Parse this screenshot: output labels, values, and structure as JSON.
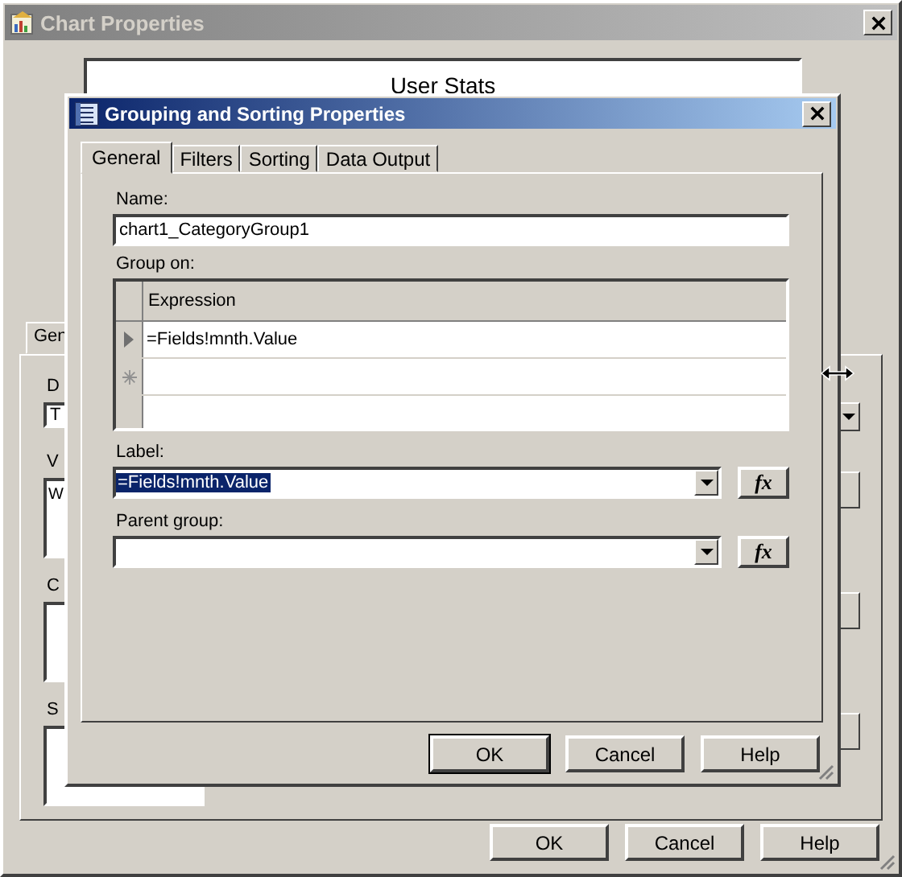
{
  "background_window": {
    "title": "Chart Properties",
    "chart_title": "User Stats",
    "tab": "Gen",
    "left_items": [
      {
        "kind": "label",
        "text": "D"
      },
      {
        "kind": "combo",
        "text": "T"
      },
      {
        "kind": "label",
        "text": "V"
      },
      {
        "kind": "list",
        "text": "W"
      },
      {
        "kind": "label",
        "text": "C"
      },
      {
        "kind": "box"
      },
      {
        "kind": "label",
        "text": "S"
      },
      {
        "kind": "box"
      }
    ],
    "buttons": [
      "OK",
      "Cancel",
      "Help"
    ]
  },
  "dialog": {
    "title": "Grouping and Sorting Properties",
    "tabs": [
      {
        "label": "General",
        "selected": true
      },
      {
        "label": "Filters",
        "selected": false
      },
      {
        "label": "Sorting",
        "selected": false
      },
      {
        "label": "Data Output",
        "selected": false
      }
    ],
    "name_label": "Name:",
    "name_value": "chart1_CategoryGroup1",
    "group_on_label": "Group on:",
    "grid": {
      "columns": [
        "Expression"
      ],
      "rows": [
        {
          "kind": "current",
          "expression": "=Fields!mnth.Value"
        },
        {
          "kind": "new"
        },
        {
          "kind": "blank"
        }
      ]
    },
    "label_field": {
      "label": "Label:",
      "value": "=Fields!mnth.Value",
      "selected": true,
      "button": "fx"
    },
    "parent_field": {
      "label": "Parent group:",
      "button": "fx"
    },
    "buttons": [
      {
        "label": "OK",
        "default": true
      },
      {
        "label": "Cancel",
        "default": false
      },
      {
        "label": "Help",
        "default": false
      }
    ]
  }
}
